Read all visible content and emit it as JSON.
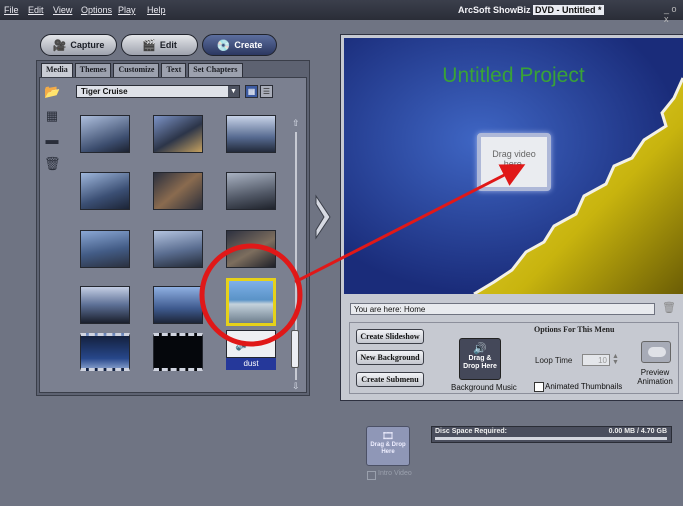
{
  "menu": [
    "File",
    "Edit",
    "View",
    "Options",
    "Play",
    "Help"
  ],
  "window": {
    "app_name": "ArcSoft ShowBiz",
    "doc_title": "DVD - Untitled *",
    "controls": "_ o x"
  },
  "modes": [
    {
      "label": "Capture",
      "icon": "camera-icon"
    },
    {
      "label": "Edit",
      "icon": "clapper-icon"
    },
    {
      "label": "Create",
      "icon": "disc-icon",
      "active": true
    }
  ],
  "tabs": [
    "Media",
    "Themes",
    "Customize",
    "Text",
    "Set Chapters"
  ],
  "side_icons": [
    "open-folder-icon",
    "organize-icon",
    "disc-drive-icon",
    "trash-icon"
  ],
  "folder": {
    "selected": "Tiger Cruise"
  },
  "media_caption": "dust",
  "preview": {
    "project_title": "Untitled Project",
    "drop_text": "Drag video here.",
    "breadcrumb": "You are here: Home"
  },
  "actions": [
    "Create Slideshow",
    "New Background",
    "Create Submenu"
  ],
  "menu_options": {
    "title": "Options For This Menu",
    "music_drop": "Drag & Drop Here",
    "music_label": "Background Music",
    "loop_label": "Loop Time",
    "loop_value": "10",
    "animated_label": "Animated Thumbnails",
    "animated_checked": false,
    "preview_label": "Preview Animation"
  },
  "intro": {
    "drop": "Drag & Drop Here",
    "checkbox_label": "Intro Video"
  },
  "disc": {
    "label": "Disc Space Required:",
    "value": "0.00 MB / 4.70 GB",
    "used_fraction": 0
  },
  "colors": {
    "accent": "#2b3760",
    "highlight": "#e6d21a",
    "annotation": "#e01818",
    "title_green": "#39a237"
  }
}
